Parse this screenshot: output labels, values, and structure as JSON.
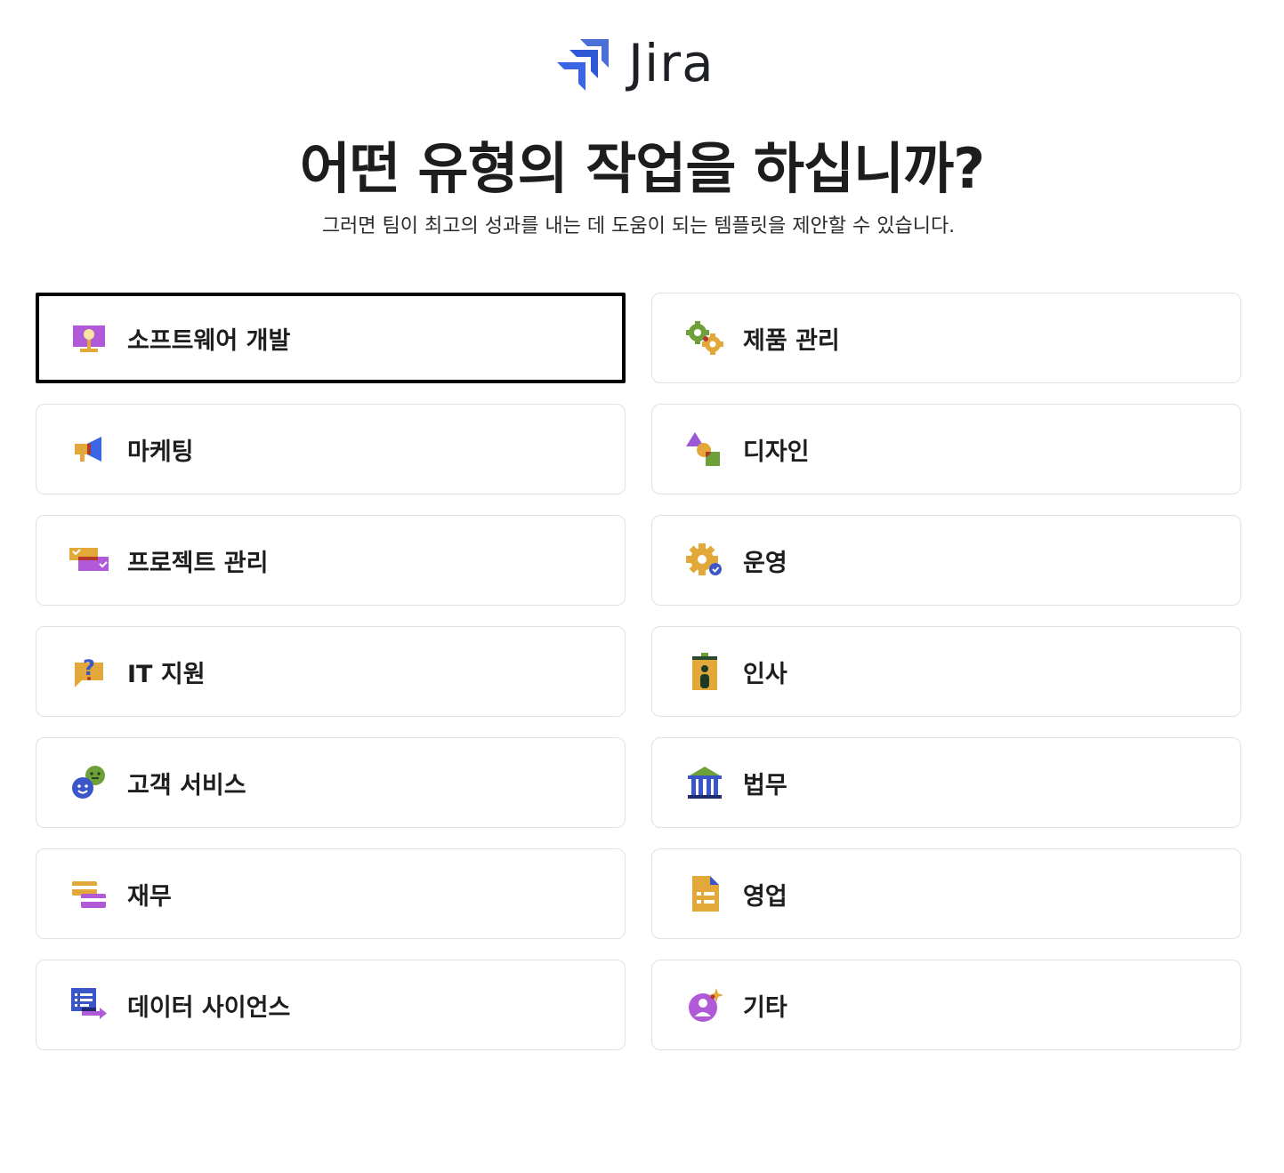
{
  "brand": {
    "name": "Jira"
  },
  "header": {
    "title": "어떤 유형의 작업을 하십니까?",
    "subtitle": "그러면 팀이 최고의 성과를 내는 데 도움이 되는 템플릿을 제안할 수 있습니다."
  },
  "work_types": [
    {
      "label": "소프트웨어 개발",
      "icon": "monitor-icon",
      "selected": true
    },
    {
      "label": "제품 관리",
      "icon": "gears-icon",
      "selected": false
    },
    {
      "label": "마케팅",
      "icon": "megaphone-icon",
      "selected": false
    },
    {
      "label": "디자인",
      "icon": "shapes-icon",
      "selected": false
    },
    {
      "label": "프로젝트 관리",
      "icon": "checked-cards-icon",
      "selected": false
    },
    {
      "label": "운영",
      "icon": "gear-check-icon",
      "selected": false
    },
    {
      "label": "IT 지원",
      "icon": "question-bubble-icon",
      "selected": false
    },
    {
      "label": "인사",
      "icon": "id-badge-icon",
      "selected": false
    },
    {
      "label": "고객 서비스",
      "icon": "smiley-chat-icon",
      "selected": false
    },
    {
      "label": "법무",
      "icon": "courthouse-icon",
      "selected": false
    },
    {
      "label": "재무",
      "icon": "credit-cards-icon",
      "selected": false
    },
    {
      "label": "영업",
      "icon": "document-icon",
      "selected": false
    },
    {
      "label": "데이터 사이언스",
      "icon": "data-list-icon",
      "selected": false
    },
    {
      "label": "기타",
      "icon": "user-sparkle-icon",
      "selected": false
    }
  ]
}
